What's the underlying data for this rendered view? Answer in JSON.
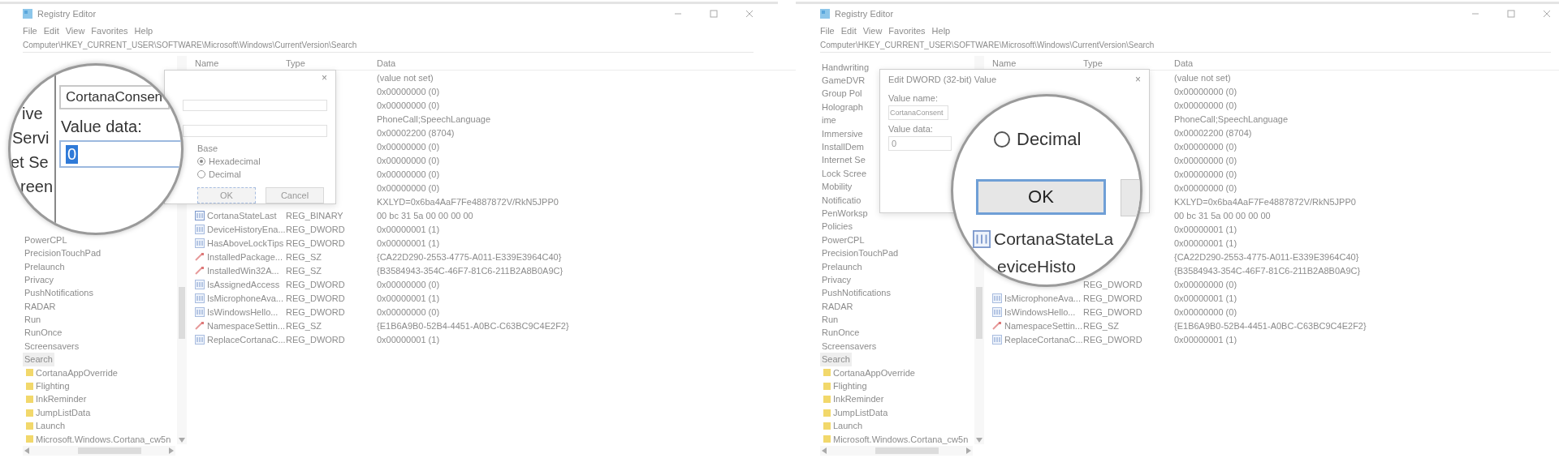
{
  "panels": [
    {
      "kind": "field-zoom",
      "window": {
        "title": "Registry Editor"
      },
      "menu": [
        "File",
        "Edit",
        "View",
        "Favorites",
        "Help"
      ],
      "address": "Computer\\HKEY_CURRENT_USER\\SOFTWARE\\Microsoft\\Windows\\CurrentVersion\\Search",
      "tree": [
        {
          "label": "PowerCPL",
          "selected": false
        },
        {
          "label": "PrecisionTouchPad",
          "selected": false
        },
        {
          "label": "Prelaunch",
          "selected": false
        },
        {
          "label": "Privacy",
          "selected": false
        },
        {
          "label": "PushNotifications",
          "selected": false
        },
        {
          "label": "RADAR",
          "selected": false
        },
        {
          "label": "Run",
          "selected": false
        },
        {
          "label": "RunOnce",
          "selected": false
        },
        {
          "label": "Screensavers",
          "selected": false
        },
        {
          "label": "Search",
          "selected": true,
          "children": [
            {
              "label": "CortanaAppOverride",
              "selected": false
            },
            {
              "label": "Flighting",
              "selected": false
            },
            {
              "label": "InkReminder",
              "selected": false
            },
            {
              "label": "JumpListData",
              "selected": false
            },
            {
              "label": "Launch",
              "selected": false
            },
            {
              "label": "Microsoft.Windows.Cortana_cw5n",
              "selected": false
            }
          ]
        }
      ],
      "columns": [
        "Name",
        "Type",
        "Data"
      ],
      "values": [
        {
          "data": "(value not set)"
        },
        {
          "data": "0x00000000 (0)"
        },
        {
          "data": "0x00000000 (0)"
        },
        {
          "data": "PhoneCall;SpeechLanguage"
        },
        {
          "data": "0x00002200 (8704)"
        },
        {
          "data": "0x00000000 (0)"
        },
        {
          "data": "0x00000000 (0)"
        },
        {
          "data": "0x00000000 (0)"
        },
        {
          "data": "0x00000000 (0)"
        },
        {
          "data": "KXLYD=0x6ba4AaF7Fe4887872V/RkN5JPP0"
        },
        {
          "name": "CortanaStateLast",
          "type": "REG_BINARY",
          "kind": "binary",
          "data": "00 bc 31 5a 00 00 00 00"
        },
        {
          "name": "DeviceHistoryEna...",
          "type": "REG_DWORD",
          "kind": "dword",
          "data": "0x00000001 (1)"
        },
        {
          "name": "HasAboveLockTips",
          "type": "REG_DWORD",
          "kind": "dword",
          "data": "0x00000001 (1)"
        },
        {
          "name": "InstalledPackage...",
          "type": "REG_SZ",
          "kind": "sz",
          "data": "{CA22D290-2553-4775-A011-E339E3964C40}"
        },
        {
          "name": "InstalledWin32A...",
          "type": "REG_SZ",
          "kind": "sz",
          "data": "{B3584943-354C-46F7-81C6-211B2A8B0A9C}"
        },
        {
          "name": "IsAssignedAccess",
          "type": "REG_DWORD",
          "kind": "dword",
          "data": "0x00000000 (0)"
        },
        {
          "name": "IsMicrophoneAva...",
          "type": "REG_DWORD",
          "kind": "dword",
          "data": "0x00000001 (1)"
        },
        {
          "name": "IsWindowsHello...",
          "type": "REG_DWORD",
          "kind": "dword",
          "data": "0x00000000 (0)"
        },
        {
          "name": "NamespaceSettin...",
          "type": "REG_SZ",
          "kind": "sz",
          "data": "{E1B6A9B0-52B4-4451-A0BC-C63BC9C4E2F2}"
        },
        {
          "name": "ReplaceCortanaC...",
          "type": "REG_DWORD",
          "kind": "dword",
          "data": "0x00000001 (1)"
        }
      ],
      "dialog": {
        "close": "×",
        "base_label": "Base",
        "radios": [
          {
            "label": "Hexadecimal",
            "selected": true
          },
          {
            "label": "Decimal",
            "selected": false
          }
        ],
        "buttons": [
          {
            "label": "OK",
            "focused": true
          },
          {
            "label": "Cancel",
            "focused": false
          }
        ]
      },
      "magnifier": {
        "tree_fragments": [
          "ive",
          "Servi",
          "et Se",
          "reen"
        ],
        "value_name": "CortanaConsen",
        "value_data_label": "Value data:",
        "value_data": "0"
      }
    },
    {
      "kind": "button-zoom",
      "window": {
        "title": "Registry Editor"
      },
      "menu": [
        "File",
        "Edit",
        "View",
        "Favorites",
        "Help"
      ],
      "address": "Computer\\HKEY_CURRENT_USER\\SOFTWARE\\Microsoft\\Windows\\CurrentVersion\\Search",
      "tree": [
        {
          "label": "Handwriting",
          "selected": false
        },
        {
          "label": "GameDVR",
          "selected": false
        },
        {
          "label": "Group Pol",
          "selected": false
        },
        {
          "label": "Holograph",
          "selected": false
        },
        {
          "label": "ime",
          "selected": false
        },
        {
          "label": "Immersive",
          "selected": false
        },
        {
          "label": "InstallDem",
          "selected": false
        },
        {
          "label": "Internet Se",
          "selected": false
        },
        {
          "label": "Lock Scree",
          "selected": false
        },
        {
          "label": "Mobility",
          "selected": false
        },
        {
          "label": "Notificatio",
          "selected": false
        },
        {
          "label": "PenWorksp",
          "selected": false
        },
        {
          "label": "Policies",
          "selected": false
        },
        {
          "label": "PowerCPL",
          "selected": false
        },
        {
          "label": "PrecisionTouchPad",
          "selected": false
        },
        {
          "label": "Prelaunch",
          "selected": false
        },
        {
          "label": "Privacy",
          "selected": false
        },
        {
          "label": "PushNotifications",
          "selected": false
        },
        {
          "label": "RADAR",
          "selected": false
        },
        {
          "label": "Run",
          "selected": false
        },
        {
          "label": "RunOnce",
          "selected": false
        },
        {
          "label": "Screensavers",
          "selected": false
        },
        {
          "label": "Search",
          "selected": true,
          "children": [
            {
              "label": "CortanaAppOverride",
              "selected": false
            },
            {
              "label": "Flighting",
              "selected": false
            },
            {
              "label": "InkReminder",
              "selected": false
            },
            {
              "label": "JumpListData",
              "selected": false
            },
            {
              "label": "Launch",
              "selected": false
            },
            {
              "label": "Microsoft.Windows.Cortana_cw5n",
              "selected": false
            }
          ]
        }
      ],
      "columns": [
        "Name",
        "Type",
        "Data"
      ],
      "values": [
        {
          "data": "(value not set)"
        },
        {
          "data": "0x00000000 (0)"
        },
        {
          "data": "0x00000000 (0)"
        },
        {
          "data": "PhoneCall;SpeechLanguage"
        },
        {
          "data": "0x00002200 (8704)"
        },
        {
          "data": "0x00000000 (0)"
        },
        {
          "data": "0x00000000 (0)"
        },
        {
          "data": "0x00000000 (0)"
        },
        {
          "data": "0x00000000 (0)"
        },
        {
          "data": "KXLYD=0x6ba4AaF7Fe4887872V/RkN5JPP0"
        },
        {
          "data": "00 bc 31 5a 00 00 00 00"
        },
        {
          "data": "0x00000001 (1)"
        },
        {
          "data": "0x00000001 (1)"
        },
        {
          "data": "{CA22D290-2553-4775-A011-E339E3964C40}"
        },
        {
          "data": "{B3584943-354C-46F7-81C6-211B2A8B0A9C}"
        },
        {
          "type": "REG_DWORD",
          "data": "0x00000000 (0)"
        },
        {
          "name": "IsMicrophoneAva...",
          "type": "REG_DWORD",
          "kind": "dword",
          "data": "0x00000001 (1)"
        },
        {
          "name": "IsWindowsHello...",
          "type": "REG_DWORD",
          "kind": "dword",
          "data": "0x00000000 (0)"
        },
        {
          "name": "NamespaceSettin...",
          "type": "REG_SZ",
          "kind": "sz",
          "data": "{E1B6A9B0-52B4-4451-A0BC-C63BC9C4E2F2}"
        },
        {
          "name": "ReplaceCortanaC...",
          "type": "REG_DWORD",
          "kind": "dword",
          "data": "0x00000001 (1)"
        }
      ],
      "dialog": {
        "title": "Edit DWORD (32-bit) Value",
        "close": "×",
        "value_name_label": "Value name:",
        "value_name": "CortanaConsent",
        "value_data_label": "Value data:",
        "value_data": "0"
      },
      "magnifier": {
        "radio": {
          "label": "Decimal",
          "selected": false
        },
        "button": {
          "label": "OK",
          "focused": true
        },
        "rows": [
          {
            "name": "CortanaStateLa",
            "kind": "binary"
          },
          {
            "name": "eviceHisto"
          }
        ]
      }
    }
  ]
}
